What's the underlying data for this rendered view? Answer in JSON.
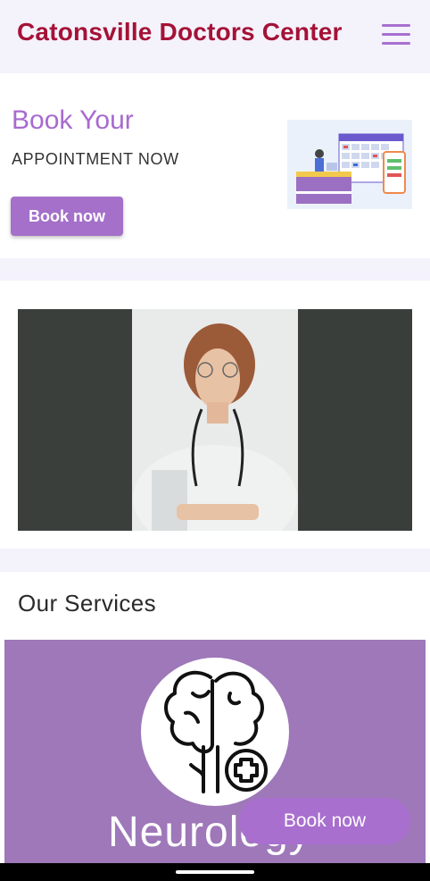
{
  "header": {
    "title": "Catonsville Doctors Center",
    "menu_icon": "hamburger-menu-icon"
  },
  "booking": {
    "title": "Book Your",
    "subtitle": "APPOINTMENT NOW",
    "button_label": "Book now"
  },
  "services": {
    "title": "Our Services",
    "current_service": "Neurology",
    "icon": "brain-plus-icon"
  },
  "floating_button": {
    "label": "Book now"
  },
  "colors": {
    "brand": "#a51237",
    "accent": "#a86fcf",
    "panel": "#9e78b9"
  }
}
